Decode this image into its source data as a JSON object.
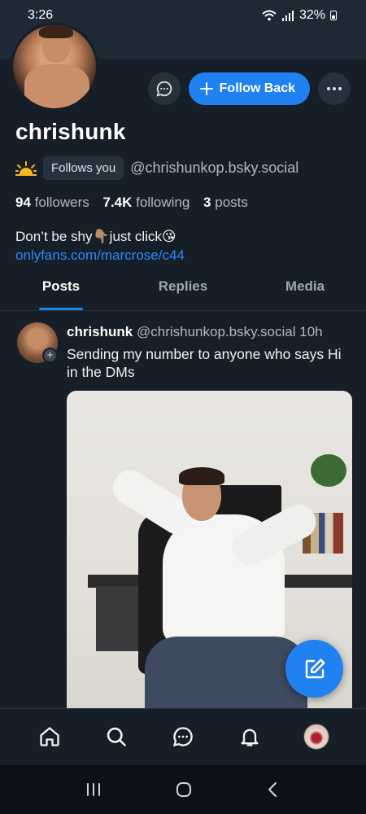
{
  "status_bar": {
    "time": "3:26",
    "battery": "32%"
  },
  "profile": {
    "display_name": "chrishunk",
    "follows_you": "Follows you",
    "handle": "@chrishunkop.bsky.social",
    "followers_count": "94",
    "followers_label": "followers",
    "following_count": "7.4K",
    "following_label": "following",
    "posts_count": "3",
    "posts_label": "posts",
    "bio_line": "Don’t be shy👇🏽just click😘",
    "bio_link": "onlyfans.com/marcrose/c44"
  },
  "actions": {
    "follow_back": "Follow Back"
  },
  "tabs": [
    {
      "label": "Posts",
      "active": true
    },
    {
      "label": "Replies",
      "active": false
    },
    {
      "label": "Media",
      "active": false
    }
  ],
  "post": {
    "author": "chrishunk",
    "handle": "@chrishunkop.bsky.social",
    "time": "10h",
    "text": "Sending my number to anyone who says Hi in the DMs"
  },
  "colors": {
    "accent": "#2081f0",
    "background": "#161e27",
    "link": "#2b8cf7"
  }
}
